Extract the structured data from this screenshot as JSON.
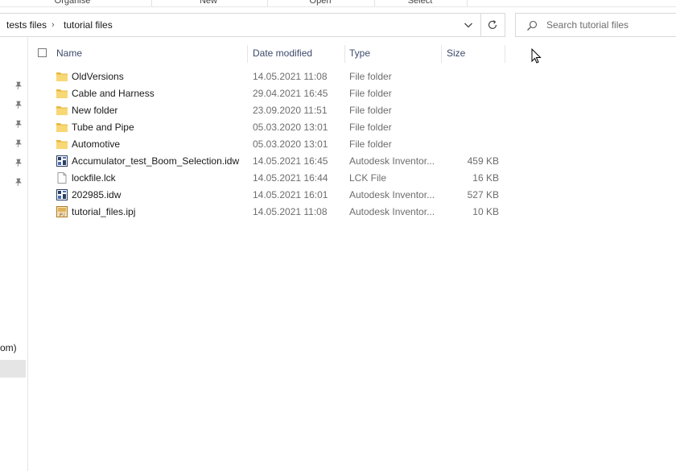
{
  "ribbon": {
    "groups": [
      "Organise",
      "New",
      "Open",
      "Select"
    ]
  },
  "address_bar": {
    "crumbs": [
      "tests files",
      "tutorial files"
    ]
  },
  "search": {
    "placeholder": "Search tutorial files"
  },
  "nav_pane": {
    "partial_label": "om)",
    "pinned_count": 6
  },
  "columns": {
    "name": "Name",
    "date": "Date modified",
    "type": "Type",
    "size": "Size"
  },
  "files": [
    {
      "name": "OldVersions",
      "date": "14.05.2021 11:08",
      "type": "File folder",
      "size": "",
      "icon": "folder-icon"
    },
    {
      "name": "Cable and Harness",
      "date": "29.04.2021 16:45",
      "type": "File folder",
      "size": "",
      "icon": "folder-icon"
    },
    {
      "name": "New folder",
      "date": "23.09.2020 11:51",
      "type": "File folder",
      "size": "",
      "icon": "folder-icon"
    },
    {
      "name": "Tube and Pipe",
      "date": "05.03.2020 13:01",
      "type": "File folder",
      "size": "",
      "icon": "folder-icon"
    },
    {
      "name": "Automotive",
      "date": "05.03.2020 13:01",
      "type": "File folder",
      "size": "",
      "icon": "folder-icon"
    },
    {
      "name": "Accumulator_test_Boom_Selection.idw",
      "date": "14.05.2021 16:45",
      "type": "Autodesk Inventor...",
      "size": "459 KB",
      "icon": "idw-file-icon"
    },
    {
      "name": "lockfile.lck",
      "date": "14.05.2021 16:44",
      "type": "LCK File",
      "size": "16 KB",
      "icon": "blank-file-icon"
    },
    {
      "name": "202985.idw",
      "date": "14.05.2021 16:01",
      "type": "Autodesk Inventor...",
      "size": "527 KB",
      "icon": "idw-file-icon"
    },
    {
      "name": "tutorial_files.ipj",
      "date": "14.05.2021 11:08",
      "type": "Autodesk Inventor...",
      "size": "10 KB",
      "icon": "ipj-file-icon"
    }
  ],
  "colors": {
    "folder": "#f8d775",
    "folder_dark": "#e8b83c",
    "header_text": "#3c4a6b",
    "secondary_text": "#6d6d6d",
    "selection": "#e5e5e5"
  }
}
